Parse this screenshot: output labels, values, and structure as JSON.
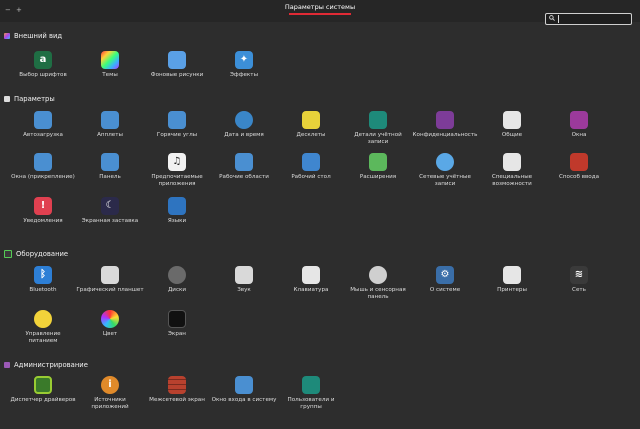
{
  "window": {
    "title": "Параметры системы",
    "minimize_glyph": "−",
    "maximize_glyph": "+"
  },
  "search": {
    "value": "",
    "placeholder": ""
  },
  "sections": {
    "appearance": {
      "title": "Внешний вид",
      "items": [
        "Выбор шрифтов",
        "Темы",
        "Фоновые рисунки",
        "Эффекты"
      ]
    },
    "preferences": {
      "title": "Параметры",
      "items": [
        "Автозагрузка",
        "Апплеты",
        "Горячие углы",
        "Дата и время",
        "Десклеты",
        "Детали учётной\nзаписи",
        "Конфиденциальность",
        "Общие",
        "Окна",
        "Окна (прикрепление)",
        "Панель",
        "Предпочитаемые\nприложения",
        "Рабочие области",
        "Рабочий стол",
        "Расширения",
        "Сетевые учётные\nзаписи",
        "Специальные\nвозможности",
        "Способ ввода",
        "Уведомления",
        "Экранная заставка",
        "Языки"
      ]
    },
    "hardware": {
      "title": "Оборудование",
      "items": [
        "Bluetooth",
        "Графический планшет",
        "Диски",
        "Звук",
        "Клавиатура",
        "Мышь и сенсорная\nпанель",
        "О системе",
        "Принтеры",
        "Сеть",
        "Управление\nпитанием",
        "Цвет",
        "Экран"
      ]
    },
    "administration": {
      "title": "Администрирование",
      "items": [
        "Диспетчер драйверов",
        "Источники\nприложений",
        "Межсетевой экран",
        "Окно входа в систему",
        "Пользователи и\nгруппы"
      ]
    }
  },
  "icon_glyphs": {
    "fonts": "a",
    "cursor": "|",
    "bell": "!",
    "moon": "☾",
    "info": "i",
    "gear": "⚙",
    "music": "♫",
    "star": "✦",
    "bluetooth": "ᛒ",
    "wifi": "≋"
  },
  "colors": {
    "accent_red": "#e02a35",
    "window_bg": "#2d2d2d",
    "titlebar_bg": "#262626"
  }
}
